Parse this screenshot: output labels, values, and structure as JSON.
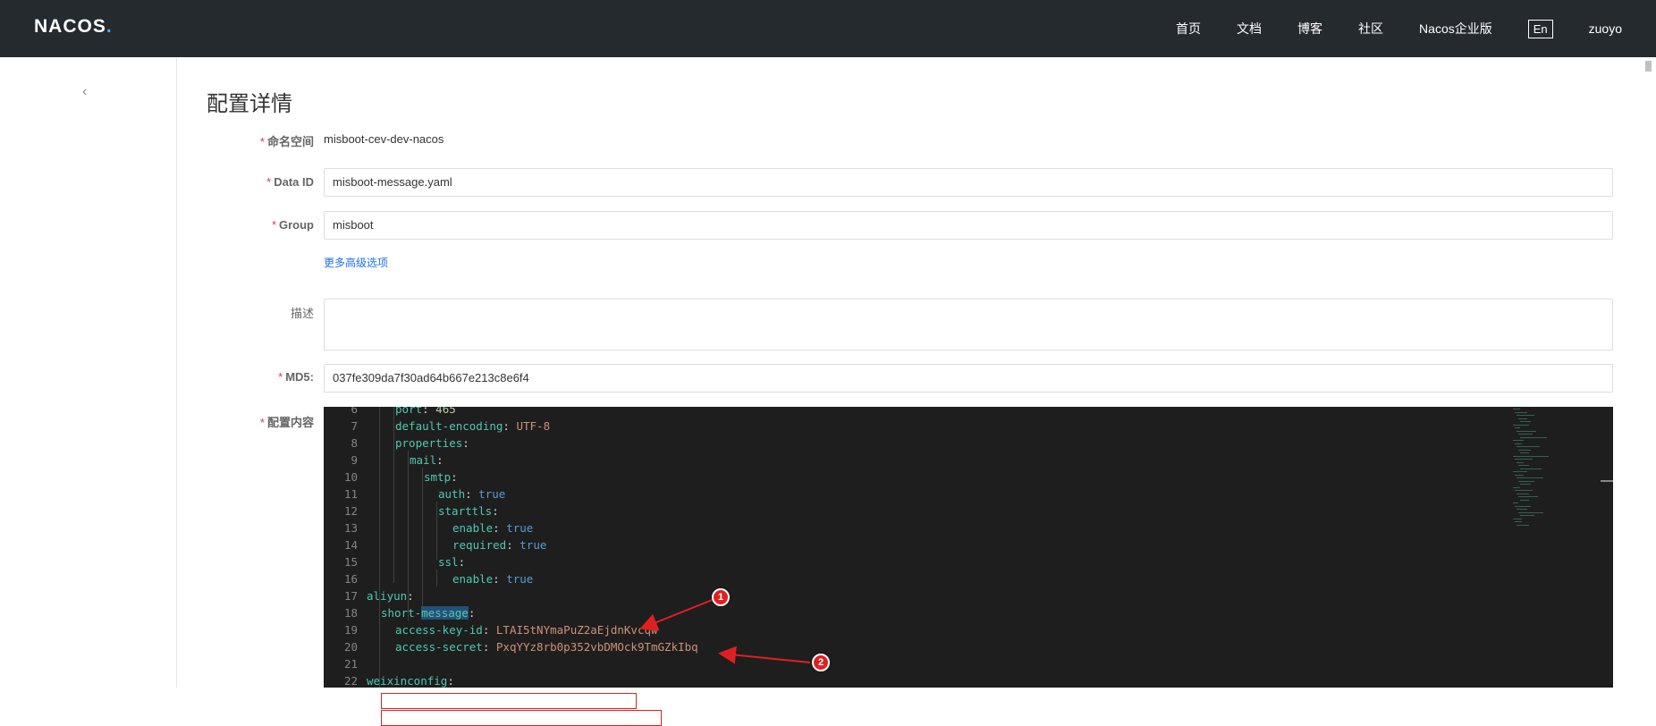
{
  "header": {
    "logo": {
      "na": "NA",
      "co": "COS",
      "dot": "."
    },
    "nav": [
      "首页",
      "文档",
      "博客",
      "社区",
      "Nacos企业版"
    ],
    "lang": "En",
    "user": "zuoyo"
  },
  "sidebar": {
    "collapse_icon": "chevron-left-icon",
    "collapse_glyph": "‹"
  },
  "page": {
    "title": "配置详情"
  },
  "form": {
    "namespace": {
      "label": "命名空间",
      "value": "misboot-cev-dev-nacos"
    },
    "data_id": {
      "label": "Data ID",
      "value": "misboot-message.yaml"
    },
    "group": {
      "label": "Group",
      "value": "misboot"
    },
    "advanced_link": "更多高级选项",
    "description": {
      "label": "描述",
      "value": ""
    },
    "md5": {
      "label": "MD5:",
      "value": "037fe309da7f30ad64b667e213c8e6f4"
    },
    "content": {
      "label": "配置内容"
    },
    "required_mark": "*"
  },
  "editor": {
    "lines": [
      {
        "num": "6",
        "key": "port",
        "sep": ": ",
        "val": "465",
        "val_type": "number"
      },
      {
        "num": "7",
        "key": "default-encoding",
        "sep": ": ",
        "val": "UTF-8",
        "val_type": "string"
      },
      {
        "num": "8",
        "key": "properties",
        "sep": ":",
        "val": "",
        "val_type": "none"
      },
      {
        "num": "9",
        "key": "mail",
        "sep": ":",
        "val": "",
        "val_type": "none"
      },
      {
        "num": "10",
        "key": "smtp",
        "sep": ":",
        "val": "",
        "val_type": "none"
      },
      {
        "num": "11",
        "key": "auth",
        "sep": ": ",
        "val": "true",
        "val_type": "bool"
      },
      {
        "num": "12",
        "key": "starttls",
        "sep": ":",
        "val": "",
        "val_type": "none"
      },
      {
        "num": "13",
        "key": "enable",
        "sep": ": ",
        "val": "true",
        "val_type": "bool"
      },
      {
        "num": "14",
        "key": "required",
        "sep": ": ",
        "val": "true",
        "val_type": "bool"
      },
      {
        "num": "15",
        "key": "ssl",
        "sep": ":",
        "val": "",
        "val_type": "none"
      },
      {
        "num": "16",
        "key": "enable",
        "sep": ": ",
        "val": "true",
        "val_type": "bool"
      },
      {
        "num": "17",
        "key": "aliyun",
        "sep": ":",
        "val": "",
        "val_type": "none"
      },
      {
        "num": "18",
        "key_pre": "short-",
        "key_sel": "message",
        "sep": ":",
        "val": "",
        "val_type": "none"
      },
      {
        "num": "19",
        "key": "access-key-id",
        "sep": ": ",
        "val": "LTAI5tNYmaPuZ2aEjdnKvcqw",
        "val_type": "string"
      },
      {
        "num": "20",
        "key": "access-secret",
        "sep": ": ",
        "val": "PxqYYz8rb0p352vbDMOck9TmGZkIbq",
        "val_type": "string"
      },
      {
        "num": "21",
        "key": "",
        "sep": "",
        "val": "",
        "val_type": "none"
      },
      {
        "num": "22",
        "key": "weixinconfig",
        "sep": ":",
        "val": "",
        "val_type": "none"
      }
    ]
  },
  "annotations": {
    "badge1": "1",
    "badge2": "2",
    "color": "#e02020"
  },
  "colors": {
    "header_bg": "#252a2f",
    "link": "#1e6ff5",
    "required": "#e4393c",
    "editor_bg": "#1e1e1e"
  }
}
